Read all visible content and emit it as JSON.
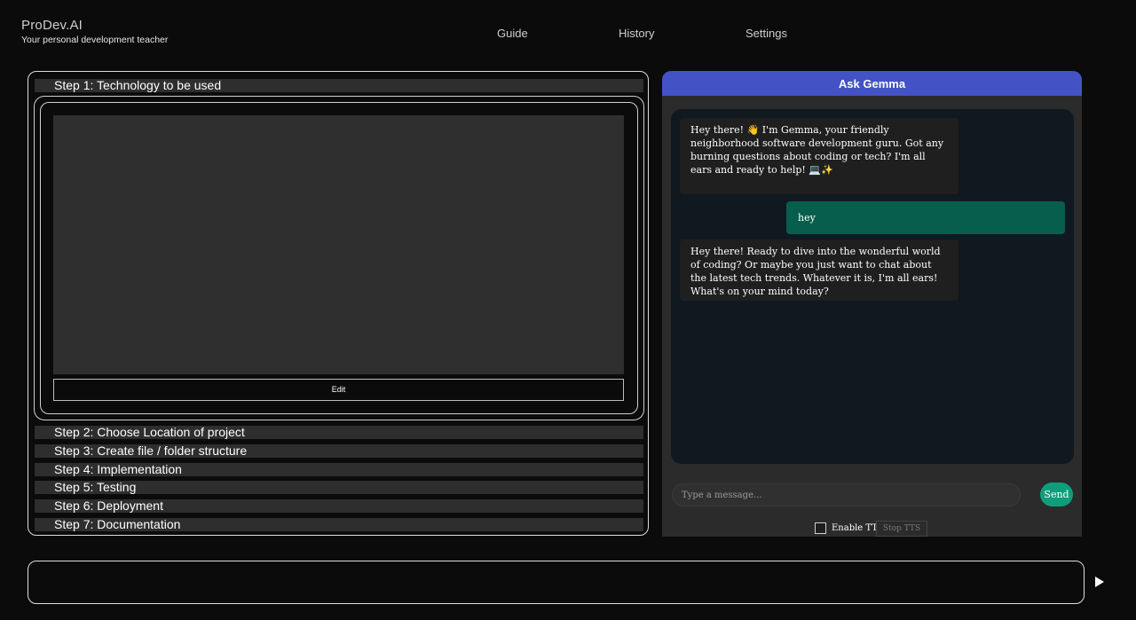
{
  "brand": {
    "name": "ProDev.AI",
    "tagline": "Your personal development teacher"
  },
  "nav": [
    "Guide",
    "History",
    "Settings"
  ],
  "steps": [
    "Step 1: Technology to be used",
    "Step 2: Choose Location of project",
    "Step 3: Create file / folder structure",
    "Step 4: Implementation",
    "Step 5: Testing",
    "Step 6: Deployment",
    "Step 7: Documentation"
  ],
  "step_edit_label": "Edit",
  "chat": {
    "title": "Ask Gemma",
    "messages": [
      {
        "role": "assistant",
        "text": "Hey there! 👋 I'm Gemma, your friendly neighborhood software development guru. Got any burning questions about coding or tech? I'm all ears and ready to help! 💻✨"
      },
      {
        "role": "user",
        "text": "hey"
      },
      {
        "role": "assistant",
        "text": "Hey there! Ready to dive into the wonderful world of coding? Or maybe you just want to chat about the latest tech trends. Whatever it is, I'm all ears! What's on your mind today?"
      }
    ],
    "input_placeholder": "Type a message...",
    "send_label": "Send",
    "tts_label": "Enable TTS",
    "stop_tts_label": "Stop TTS"
  },
  "icons": {
    "run": "play-icon"
  },
  "colors": {
    "chat_header": "#4352c4",
    "user_bubble": "#075e4d",
    "send_button": "#0f9e7c"
  }
}
